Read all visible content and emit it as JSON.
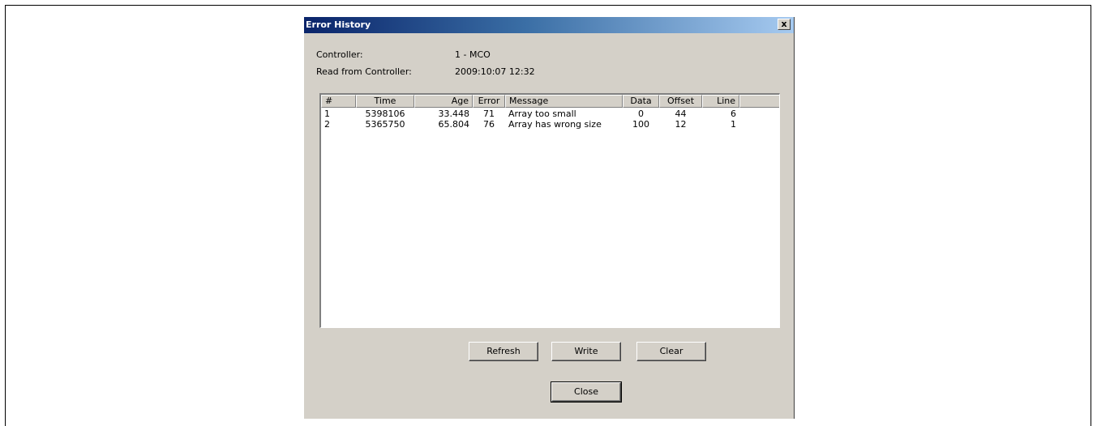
{
  "window": {
    "title": "Error History",
    "close_glyph": "x"
  },
  "info": {
    "controller_label": "Controller:",
    "controller_value": "1 - MCO",
    "read_label": "Read from Controller:",
    "read_value": "2009:10:07 12:32"
  },
  "table": {
    "columns": [
      "#",
      "Time",
      "Age",
      "Error",
      "Message",
      "Data",
      "Offset",
      "Line"
    ],
    "rows": [
      [
        "1",
        "5398106",
        "33.448",
        "71",
        "Array too small",
        "0",
        "44",
        "6"
      ],
      [
        "2",
        "5365750",
        "65.804",
        "76",
        "Array has wrong size",
        "100",
        "12",
        "1"
      ]
    ]
  },
  "buttons": {
    "refresh": "Refresh",
    "write": "Write",
    "clear": "Clear",
    "close": "Close"
  },
  "icons": {
    "close": "close-icon"
  },
  "colors": {
    "titlebar_start": "#0a246a",
    "titlebar_end": "#a6caf0",
    "dialog_bg": "#d4d0c8"
  }
}
